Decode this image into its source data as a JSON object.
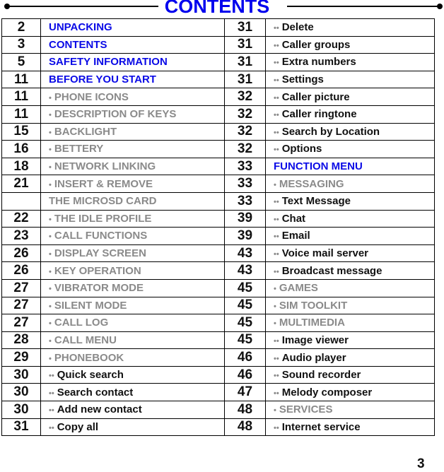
{
  "title": "CONTENTS",
  "page_number": "3",
  "rows": [
    {
      "lp": "2",
      "lb": "",
      "lt": "UNPACKING",
      "ls": "heading",
      "rp": "31",
      "rb": "••",
      "rt": "Delete",
      "rs": "subsub"
    },
    {
      "lp": "3",
      "lb": "",
      "lt": "CONTENTS",
      "ls": "heading",
      "rp": "31",
      "rb": "••",
      "rt": "Caller  groups",
      "rs": "subsub"
    },
    {
      "lp": "5",
      "lb": "",
      "lt": "SAFETY INFORMATION",
      "ls": "heading",
      "rp": "31",
      "rb": "••",
      "rt": "Extra numbers",
      "rs": "subsub"
    },
    {
      "lp": "11",
      "lb": "",
      "lt": "BEFORE YOU START",
      "ls": "heading",
      "rp": "31",
      "rb": "••",
      "rt": "Settings",
      "rs": "subsub"
    },
    {
      "lp": "11",
      "lb": "•",
      "lt": "PHONE ICONS",
      "ls": "sub",
      "rp": "32",
      "rb": "••",
      "rt": "Caller  picture",
      "rs": "subsub"
    },
    {
      "lp": "11",
      "lb": "•",
      "lt": "DESCRIPTION OF KEYS",
      "ls": "sub",
      "rp": "32",
      "rb": "••",
      "rt": "Caller ringtone",
      "rs": "subsub"
    },
    {
      "lp": "15",
      "lb": "•",
      "lt": "BACKLIGHT",
      "ls": "sub",
      "rp": "32",
      "rb": "••",
      "rt": "Search by Location",
      "rs": "subsub"
    },
    {
      "lp": "16",
      "lb": "•",
      "lt": "BETTERY",
      "ls": "sub",
      "rp": "32",
      "rb": "••",
      "rt": "Options",
      "rs": "subsub"
    },
    {
      "lp": "18",
      "lb": "•",
      "lt": "NETWORK LINKING",
      "ls": "sub",
      "rp": "33",
      "rb": "",
      "rt": "FUNCTION MENU",
      "rs": "heading"
    },
    {
      "lp": "21",
      "lb": "•",
      "lt": "INSERT & REMOVE",
      "ls": "sub",
      "rp": "33",
      "rb": "•",
      "rt": "MESSAGING",
      "rs": "sub"
    },
    {
      "lp": "",
      "lb": "",
      "lt": "THE MICROSD CARD",
      "ls": "sub cont",
      "rp": "33",
      "rb": "••",
      "rt": "Text Message",
      "rs": "subsub"
    },
    {
      "lp": "22",
      "lb": "•",
      "lt": "THE IDLE PROFILE",
      "ls": "sub",
      "rp": "39",
      "rb": "••",
      "rt": "Chat",
      "rs": "subsub"
    },
    {
      "lp": "23",
      "lb": "•",
      "lt": "CALL FUNCTIONS",
      "ls": "sub",
      "rp": "39",
      "rb": "••",
      "rt": "Email",
      "rs": "subsub"
    },
    {
      "lp": "26",
      "lb": "•",
      "lt": "DISPLAY SCREEN",
      "ls": "sub",
      "rp": "43",
      "rb": "••",
      "rt": "Voice mail server",
      "rs": "subsub"
    },
    {
      "lp": "26",
      "lb": "•",
      "lt": "KEY OPERATION",
      "ls": "sub",
      "rp": "43",
      "rb": "••",
      "rt": "Broadcast message",
      "rs": "subsub"
    },
    {
      "lp": "27",
      "lb": "•",
      "lt": "VIBRATOR MODE",
      "ls": "sub",
      "rp": "45",
      "rb": "•",
      "rt": "GAMES",
      "rs": "sub"
    },
    {
      "lp": "27",
      "lb": "•",
      "lt": "SILENT MODE",
      "ls": "sub",
      "rp": "45",
      "rb": "•",
      "rt": "SIM TOOLKIT",
      "rs": "sub"
    },
    {
      "lp": "27",
      "lb": "•",
      "lt": "CALL LOG",
      "ls": "sub",
      "rp": "45",
      "rb": "•",
      "rt": "MULTIMEDIA",
      "rs": "sub"
    },
    {
      "lp": "28",
      "lb": "•",
      "lt": "CALL MENU",
      "ls": "sub",
      "rp": "45",
      "rb": "••",
      "rt": "Image viewer",
      "rs": "subsub"
    },
    {
      "lp": "29",
      "lb": "•",
      "lt": "PHONEBOOK",
      "ls": "sub",
      "rp": "46",
      "rb": "••",
      "rt": "Audio player",
      "rs": "subsub"
    },
    {
      "lp": "30",
      "lb": "••",
      "lt": "Quick  search",
      "ls": "subsub",
      "rp": "46",
      "rb": "••",
      "rt": "Sound recorder",
      "rs": "subsub"
    },
    {
      "lp": "30",
      "lb": "••",
      "lt": "Search  contact",
      "ls": "subsub",
      "rp": "47",
      "rb": "••",
      "rt": "Melody composer",
      "rs": "subsub"
    },
    {
      "lp": "30",
      "lb": "••",
      "lt": "Add new contact",
      "ls": "subsub",
      "rp": "48",
      "rb": "•",
      "rt": "SERVICES",
      "rs": "sub"
    },
    {
      "lp": "31",
      "lb": "••",
      "lt": "Copy  all",
      "ls": "subsub",
      "rp": "48",
      "rb": "••",
      "rt": "Internet service",
      "rs": "subsub"
    }
  ]
}
